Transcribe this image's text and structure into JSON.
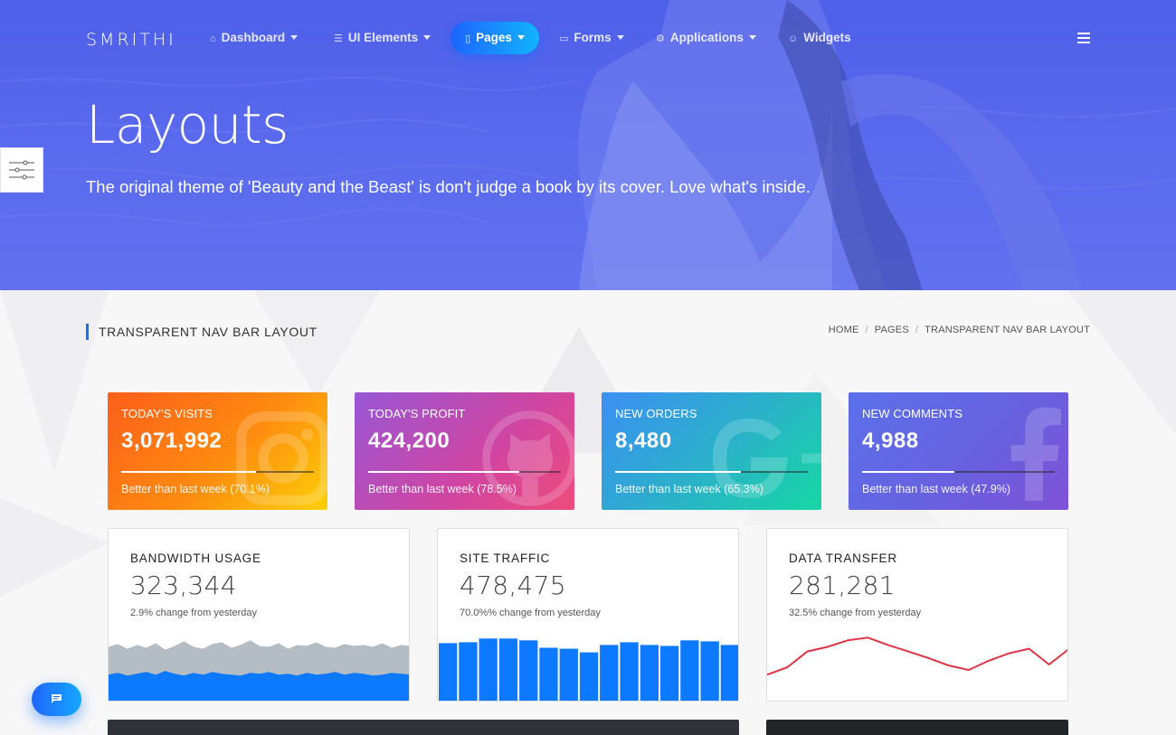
{
  "brand": "SMRITHI",
  "nav": {
    "items": [
      {
        "label": "Dashboard",
        "icon": "home-icon",
        "caret": true
      },
      {
        "label": "UI Elements",
        "icon": "sliders-icon",
        "caret": true
      },
      {
        "label": "Pages",
        "icon": "book-icon",
        "caret": true,
        "active": true
      },
      {
        "label": "Forms",
        "icon": "folder-icon",
        "caret": true
      },
      {
        "label": "Applications",
        "icon": "gear-icon",
        "caret": true
      },
      {
        "label": "Widgets",
        "icon": "smile-icon",
        "caret": false
      }
    ]
  },
  "hero": {
    "title": "Layouts",
    "subtitle": "The original theme of 'Beauty and the Beast' is don't judge a book by its cover. Love what's inside."
  },
  "section": {
    "title": "TRANSPARENT NAV BAR LAYOUT",
    "breadcrumb": [
      "HOME",
      "PAGES",
      "TRANSPARENT NAV BAR LAYOUT"
    ]
  },
  "stats": [
    {
      "label": "TODAY'S VISITS",
      "value": "3,071,992",
      "progress": 0.701,
      "footer": "Better than last week (70.1%)",
      "icon": "instagram-icon"
    },
    {
      "label": "TODAY'S PROFIT",
      "value": "424,200",
      "progress": 0.785,
      "footer": "Better than last week (78.5%)",
      "icon": "github-icon"
    },
    {
      "label": "NEW ORDERS",
      "value": "8,480",
      "progress": 0.653,
      "footer": "Better than last week (65.3%)",
      "icon": "google-icon"
    },
    {
      "label": "NEW COMMENTS",
      "value": "4,988",
      "progress": 0.479,
      "footer": "Better than last week (47.9%)",
      "icon": "facebook-icon"
    }
  ],
  "mini_cards": [
    {
      "title": "BANDWIDTH USAGE",
      "value": "323,344",
      "sub": "2.9% change from yesterday"
    },
    {
      "title": "SITE TRAFFIC",
      "value": "478,475",
      "sub": "70.0%% change from yesterday"
    },
    {
      "title": "DATA TRANSFER",
      "value": "281,281",
      "sub": "32.5% change from yesterday"
    }
  ],
  "colors": {
    "accent": "#1372f5",
    "bar_blue": "#0d79ff",
    "line_red": "#dc3545",
    "area_gray": "#b4bcc4"
  },
  "chart_data": [
    {
      "type": "area",
      "series": [
        {
          "values": [
            60,
            63,
            58,
            62,
            59,
            64,
            57,
            61,
            66,
            60,
            58,
            63,
            65,
            59,
            62,
            67,
            61,
            60,
            64,
            58,
            62,
            61,
            65,
            60,
            59,
            63,
            61,
            62,
            60,
            64,
            59,
            62,
            61
          ]
        },
        {
          "values": [
            30,
            32,
            29,
            31,
            33,
            30,
            34,
            31,
            29,
            32,
            30,
            33,
            31,
            30,
            29,
            32,
            31,
            33,
            30,
            31,
            29,
            32,
            30,
            31,
            33,
            30,
            32,
            31,
            29,
            30,
            32,
            31,
            30
          ]
        }
      ]
    },
    {
      "type": "bar",
      "values": [
        64,
        65,
        69,
        69,
        67,
        59,
        58,
        54,
        62,
        65,
        62,
        61,
        67,
        66,
        62
      ]
    },
    {
      "type": "line",
      "values": [
        30,
        38,
        55,
        60,
        67,
        70,
        62,
        55,
        48,
        40,
        35,
        45,
        53,
        58,
        41,
        58
      ]
    }
  ]
}
